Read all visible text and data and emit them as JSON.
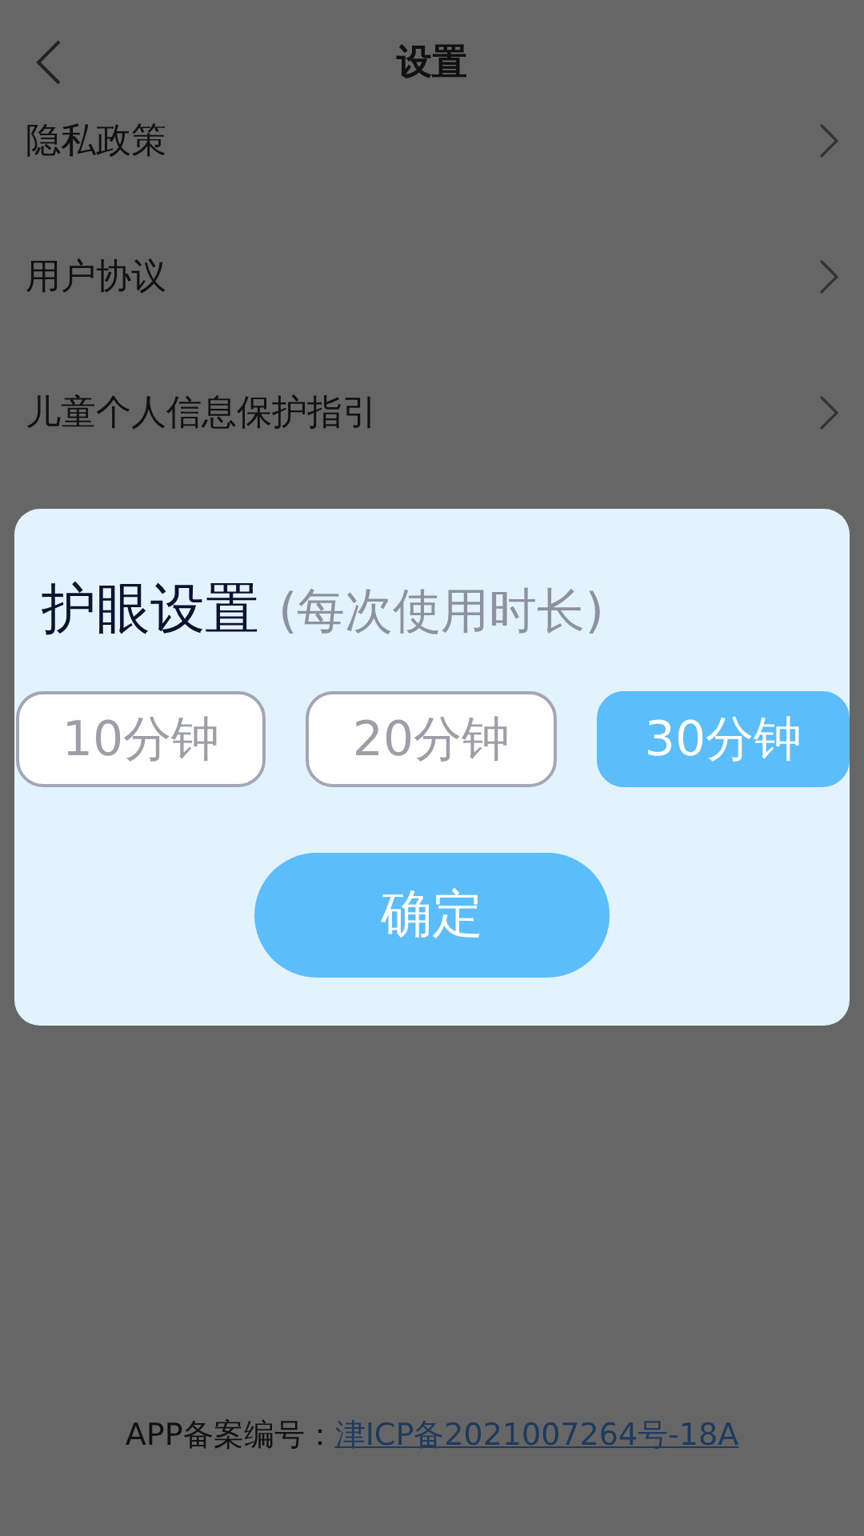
{
  "header": {
    "title": "设置"
  },
  "items": [
    {
      "label": "隐私政策"
    },
    {
      "label": "用户协议"
    },
    {
      "label": "儿童个人信息保护指引"
    }
  ],
  "dialog": {
    "title": "护眼设置",
    "subtitle": "(每次使用时长)",
    "options": [
      {
        "label": "10分钟",
        "selected": false
      },
      {
        "label": "20分钟",
        "selected": false
      },
      {
        "label": "30分钟",
        "selected": true
      }
    ],
    "confirm": "确定"
  },
  "footer": {
    "label": "APP备案编号：",
    "link": "津ICP备2021007264号-18A"
  }
}
